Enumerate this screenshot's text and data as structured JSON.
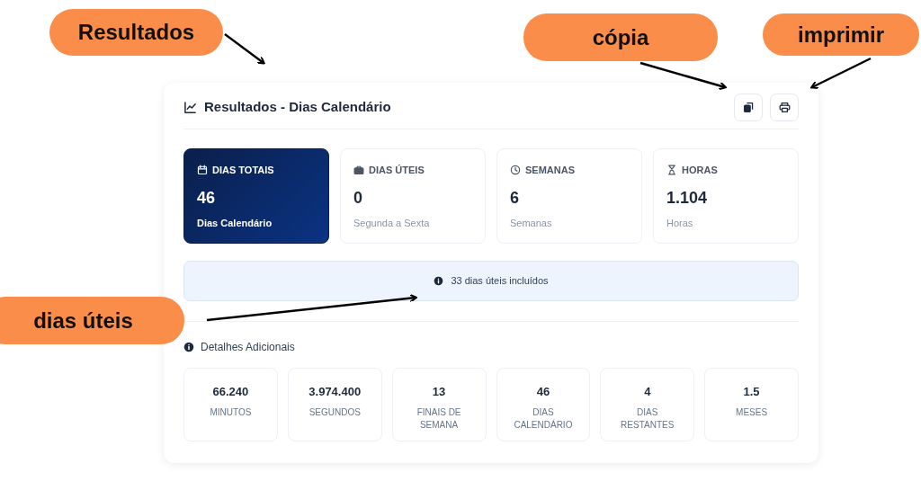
{
  "annotations": [
    {
      "label": "Resultados"
    },
    {
      "label": "cópia"
    },
    {
      "label": "imprimir"
    },
    {
      "label": "dias úteis"
    }
  ],
  "panel": {
    "title": "Resultados - Dias Calendário",
    "stats": [
      {
        "label": "DIAS TOTAIS",
        "value": "46",
        "caption": "Dias Calendário",
        "highlighted": true
      },
      {
        "label": "DIAS ÚTEIS",
        "value": "0",
        "caption": "Segunda a Sexta",
        "highlighted": false
      },
      {
        "label": "SEMANAS",
        "value": "6",
        "caption": "Semanas",
        "highlighted": false
      },
      {
        "label": "HORAS",
        "value": "1.104",
        "caption": "Horas",
        "highlighted": false
      }
    ],
    "notice": "33 dias úteis incluídos",
    "details_title": "Detalhes Adicionais",
    "details": [
      {
        "value": "66.240",
        "label": "MINUTOS"
      },
      {
        "value": "3.974.400",
        "label": "SEGUNDOS"
      },
      {
        "value": "13",
        "label": "FINAIS DE SEMANA"
      },
      {
        "value": "46",
        "label": "DIAS CALENDÁRIO"
      },
      {
        "value": "4",
        "label": "DIAS RESTANTES"
      },
      {
        "value": "1.5",
        "label": "MESES"
      }
    ]
  }
}
